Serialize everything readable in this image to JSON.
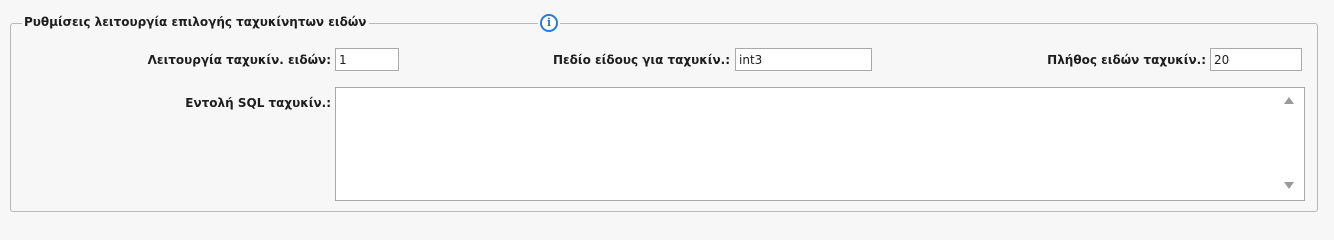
{
  "section": {
    "title": "Ρυθμίσεις λειτουργία επιλογής ταχυκίνητων ειδών",
    "info_icon": "info-icon"
  },
  "fields": {
    "mode": {
      "label": "Λειτουργία ταχυκίν. ειδών:",
      "value": "1"
    },
    "item_field": {
      "label": "Πεδίο είδους για ταχυκίν.:",
      "value": "int3"
    },
    "count": {
      "label": "Πλήθος ειδών ταχυκίν.:",
      "value": "20"
    },
    "sql": {
      "label": "Εντολή SQL ταχυκίν.:",
      "value": ""
    }
  },
  "colors": {
    "accent": "#2a7bd8",
    "border": "#a9a9a9",
    "background": "#f7f7f7"
  }
}
